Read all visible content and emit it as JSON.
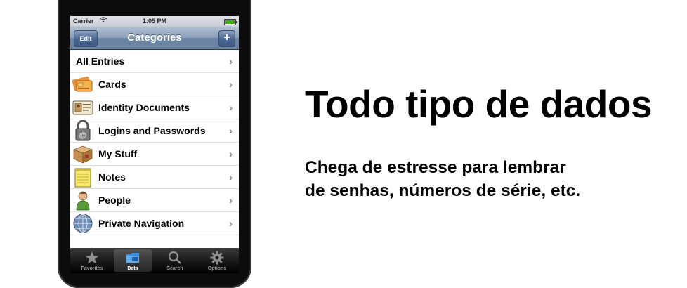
{
  "status_bar": {
    "carrier": "Carrier",
    "time": "1:05 PM"
  },
  "nav_bar": {
    "title": "Categories",
    "edit_label": "Edit",
    "add_label": "+"
  },
  "list": [
    {
      "label": "All Entries",
      "icon": "none"
    },
    {
      "label": "Cards",
      "icon": "card-icon"
    },
    {
      "label": "Identity Documents",
      "icon": "id-card-icon"
    },
    {
      "label": "Logins and Passwords",
      "icon": "padlock-icon"
    },
    {
      "label": "My Stuff",
      "icon": "box-icon"
    },
    {
      "label": "Notes",
      "icon": "notepad-icon"
    },
    {
      "label": "People",
      "icon": "person-icon"
    },
    {
      "label": "Private Navigation",
      "icon": "globe-icon"
    }
  ],
  "chevron": "›",
  "tab_bar": [
    {
      "label": "Favorites",
      "icon": "star-icon",
      "selected": false
    },
    {
      "label": "Data",
      "icon": "folder-icon",
      "selected": true
    },
    {
      "label": "Search",
      "icon": "magnifier-icon",
      "selected": false
    },
    {
      "label": "Options",
      "icon": "gear-icon",
      "selected": false
    }
  ],
  "promo": {
    "headline": "Todo tipo de dados",
    "subline_1": "Chega de estresse para lembrar",
    "subline_2": "de senhas, números de série, etc."
  }
}
